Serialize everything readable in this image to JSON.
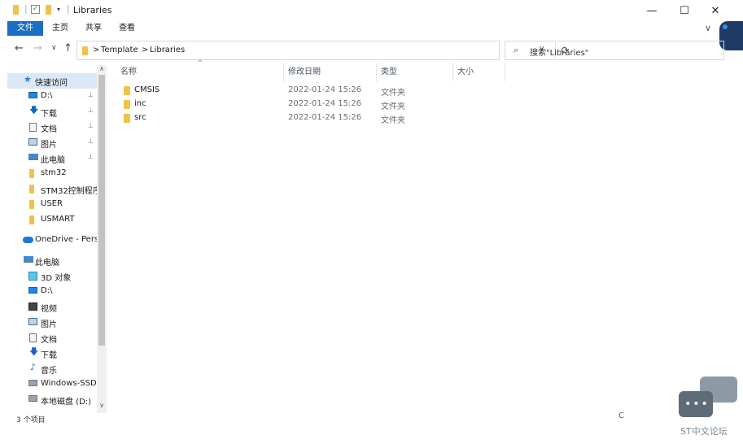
{
  "window": {
    "title": "Libraries",
    "minimize_glyph": "—",
    "maximize_glyph": "☐",
    "close_glyph": "✕"
  },
  "ribbon": {
    "tabs": [
      "文件",
      "主页",
      "共享",
      "查看"
    ],
    "expand_glyph": "∨"
  },
  "nav": {
    "back": "←",
    "forward": "→",
    "recent": "∨",
    "up": "↑"
  },
  "address": {
    "crumbs": [
      "Template",
      "Libraries"
    ],
    "separator": ">",
    "refresh_glyph": "⟳",
    "dropdown_glyph": "∨"
  },
  "search": {
    "placeholder": "搜索\"Libraries\"",
    "icon": "search-icon"
  },
  "sidebar": {
    "items": [
      {
        "label": "快速访问",
        "icon": "star-icon"
      },
      {
        "label": "D:\\",
        "icon": "drive-icon",
        "pinned": true
      },
      {
        "label": "下载",
        "icon": "download-icon",
        "pinned": true
      },
      {
        "label": "文档",
        "icon": "document-icon",
        "pinned": true
      },
      {
        "label": "图片",
        "icon": "picture-icon",
        "pinned": true
      },
      {
        "label": "此电脑",
        "icon": "computer-icon",
        "pinned": true
      },
      {
        "label": "stm32",
        "icon": "folder-icon"
      },
      {
        "label": "STM32控制程序",
        "icon": "folder-icon"
      },
      {
        "label": "USER",
        "icon": "folder-icon"
      },
      {
        "label": "USMART",
        "icon": "folder-icon"
      },
      {
        "label": "OneDrive - Perso",
        "icon": "onedrive-icon"
      },
      {
        "label": "此电脑",
        "icon": "computer-icon"
      },
      {
        "label": "3D 对象",
        "icon": "3d-objects-icon"
      },
      {
        "label": "D:\\",
        "icon": "drive-icon"
      },
      {
        "label": "视频",
        "icon": "video-icon"
      },
      {
        "label": "图片",
        "icon": "picture-icon"
      },
      {
        "label": "文档",
        "icon": "document-icon"
      },
      {
        "label": "下载",
        "icon": "download-icon"
      },
      {
        "label": "音乐",
        "icon": "music-icon"
      },
      {
        "label": "Windows-SSD (",
        "icon": "ssd-icon"
      },
      {
        "label": "本地磁盘 (D:)",
        "icon": "disk-icon"
      }
    ],
    "pin_glyph": "📌"
  },
  "columns": [
    "名称",
    "修改日期",
    "类型",
    "大小"
  ],
  "files": [
    {
      "name": "CMSIS",
      "date": "2022-01-24 15:26",
      "type": "文件夹"
    },
    {
      "name": "inc",
      "date": "2022-01-24 15:26",
      "type": "文件夹"
    },
    {
      "name": "src",
      "date": "2022-01-24 15:26",
      "type": "文件夹"
    }
  ],
  "status": {
    "count": "3 个项目",
    "partial": "C"
  },
  "watermark": {
    "text": "ST中文论坛"
  }
}
